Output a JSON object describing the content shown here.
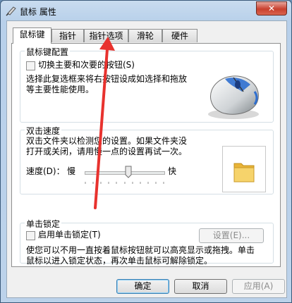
{
  "window": {
    "title": "鼠标 属性",
    "close_label": "✕"
  },
  "tabs": [
    {
      "label": "鼠标键"
    },
    {
      "label": "指针"
    },
    {
      "label": "指针选项"
    },
    {
      "label": "滑轮"
    },
    {
      "label": "硬件"
    }
  ],
  "buttons_config": {
    "group_label": "鼠标键配置",
    "swap_checkbox_label": "切换主要和次要的按钮(S)",
    "swap_checked": false,
    "description_line1": "选择此复选框来将右按钮设成如选择和拖放",
    "description_line2": "等主要性能使用。"
  },
  "double_click": {
    "group_label": "双击速度",
    "description_line1": "双击文件夹以检测您的设置。如果文件夹没",
    "description_line2": "打开或关闭，请用慢一点的设置再试一次。",
    "speed_label": "速度(D)：",
    "slow_label": "慢",
    "fast_label": "快",
    "speed_value_fraction": 0.55
  },
  "click_lock": {
    "group_label": "单击锁定",
    "checkbox_label": "启用单击锁定(T)",
    "checked": false,
    "settings_button": "设置(E)...",
    "description_line1": "使您可以不用一直按着鼠标按钮就可以高亮显示或拖拽。单击",
    "description_line2": "鼠标以进入锁定状态，再次单击鼠标可解除锁定。"
  },
  "footer": {
    "ok": "确定",
    "cancel": "取消",
    "apply": "应用(A)"
  },
  "colors": {
    "annotation_arrow": "#e8322e",
    "folder": "#f2c84b"
  }
}
